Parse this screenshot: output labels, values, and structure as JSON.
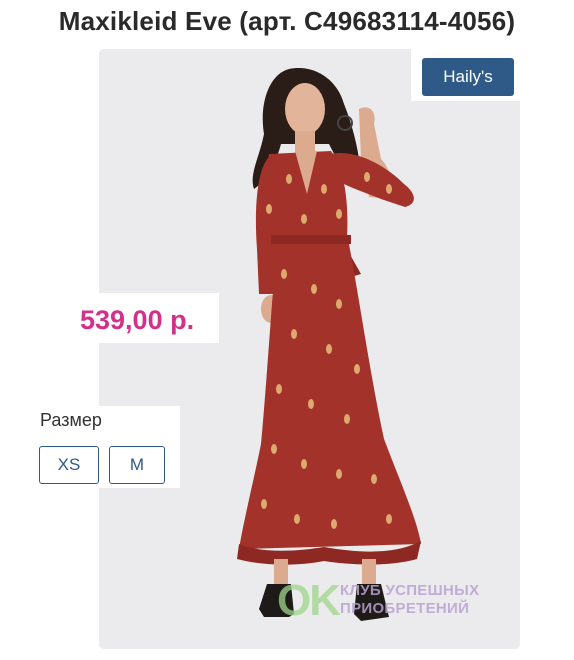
{
  "product": {
    "title": "Maxikleid Eve (арт. C49683114-4056)",
    "brand": "Haily's",
    "price": "539,00 р."
  },
  "sizes": {
    "label": "Размер",
    "options": [
      "XS",
      "M"
    ]
  },
  "watermark": {
    "logo": "OK",
    "line1": "КЛУБ УСПЕШНЫХ",
    "line2": "ПРИОБРЕТЕНИЙ"
  },
  "colors": {
    "brand_button": "#2f5a87",
    "price": "#d2318b",
    "dress": "#a3322a"
  }
}
